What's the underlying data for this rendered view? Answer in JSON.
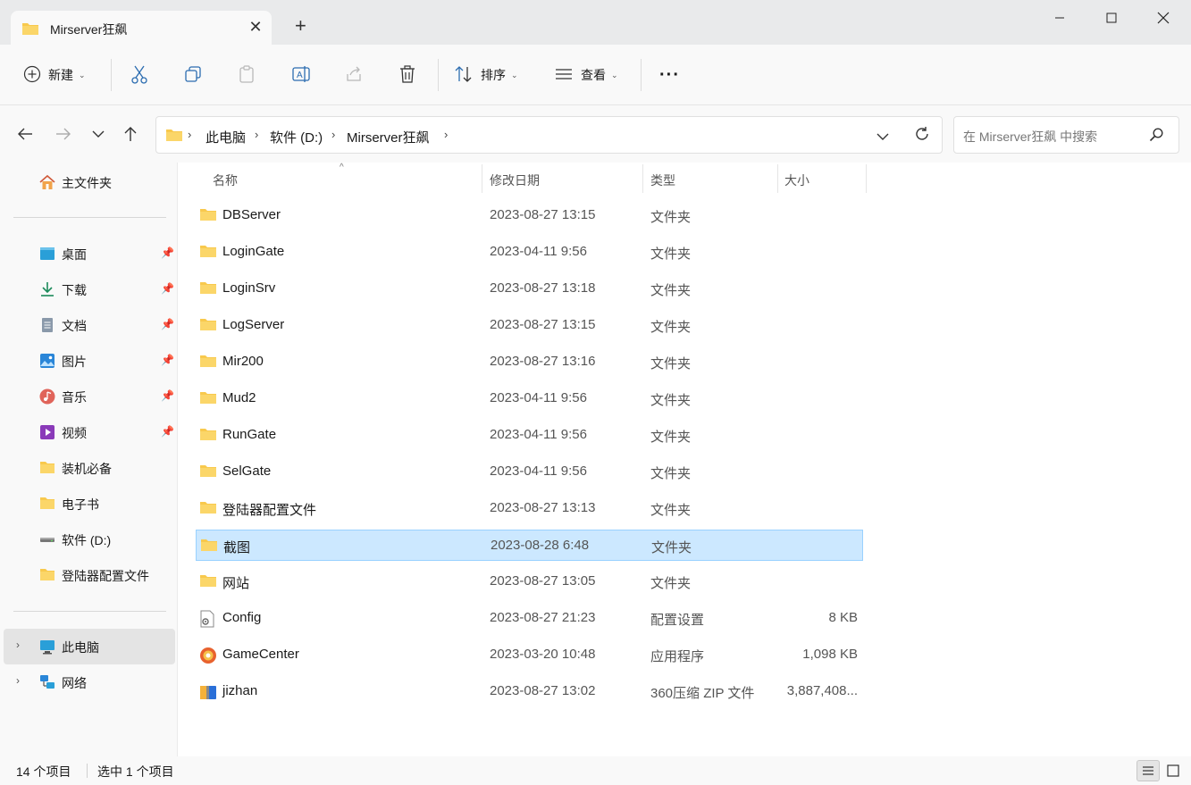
{
  "window": {
    "tab_title": "Mirserver狂飙",
    "close_tab": "✕",
    "new_tab": "+"
  },
  "toolbar": {
    "new_label": "新建",
    "sort_label": "排序",
    "view_label": "查看",
    "more_label": "···"
  },
  "address": {
    "crumbs": [
      "此电脑",
      "软件 (D:)",
      "Mirserver狂飙"
    ],
    "search_placeholder": "在 Mirserver狂飙 中搜索"
  },
  "sidebar": {
    "home": "主文件夹",
    "pinned": [
      {
        "label": "桌面",
        "icon": "desktop-icon"
      },
      {
        "label": "下载",
        "icon": "download-icon"
      },
      {
        "label": "文档",
        "icon": "document-icon"
      },
      {
        "label": "图片",
        "icon": "pictures-icon"
      },
      {
        "label": "音乐",
        "icon": "music-icon"
      },
      {
        "label": "视频",
        "icon": "video-icon"
      }
    ],
    "others": [
      {
        "label": "装机必备",
        "icon": "folder-icon"
      },
      {
        "label": "电子书",
        "icon": "folder-icon"
      },
      {
        "label": "软件 (D:)",
        "icon": "drive-icon"
      },
      {
        "label": "登陆器配置文件",
        "icon": "folder-icon"
      }
    ],
    "this_pc": "此电脑",
    "network": "网络"
  },
  "columns": {
    "name": "名称",
    "date": "修改日期",
    "type": "类型",
    "size": "大小"
  },
  "files": [
    {
      "name": "DBServer",
      "date": "2023-08-27 13:15",
      "type": "文件夹",
      "size": "",
      "icon": "folder"
    },
    {
      "name": "LoginGate",
      "date": "2023-04-11 9:56",
      "type": "文件夹",
      "size": "",
      "icon": "folder"
    },
    {
      "name": "LoginSrv",
      "date": "2023-08-27 13:18",
      "type": "文件夹",
      "size": "",
      "icon": "folder"
    },
    {
      "name": "LogServer",
      "date": "2023-08-27 13:15",
      "type": "文件夹",
      "size": "",
      "icon": "folder"
    },
    {
      "name": "Mir200",
      "date": "2023-08-27 13:16",
      "type": "文件夹",
      "size": "",
      "icon": "folder"
    },
    {
      "name": "Mud2",
      "date": "2023-04-11 9:56",
      "type": "文件夹",
      "size": "",
      "icon": "folder"
    },
    {
      "name": "RunGate",
      "date": "2023-04-11 9:56",
      "type": "文件夹",
      "size": "",
      "icon": "folder"
    },
    {
      "name": "SelGate",
      "date": "2023-04-11 9:56",
      "type": "文件夹",
      "size": "",
      "icon": "folder"
    },
    {
      "name": "登陆器配置文件",
      "date": "2023-08-27 13:13",
      "type": "文件夹",
      "size": "",
      "icon": "folder"
    },
    {
      "name": "截图",
      "date": "2023-08-28 6:48",
      "type": "文件夹",
      "size": "",
      "icon": "folder",
      "selected": true
    },
    {
      "name": "网站",
      "date": "2023-08-27 13:05",
      "type": "文件夹",
      "size": "",
      "icon": "folder"
    },
    {
      "name": "Config",
      "date": "2023-08-27 21:23",
      "type": "配置设置",
      "size": "8 KB",
      "icon": "config"
    },
    {
      "name": "GameCenter",
      "date": "2023-03-20 10:48",
      "type": "应用程序",
      "size": "1,098 KB",
      "icon": "app"
    },
    {
      "name": "jizhan",
      "date": "2023-08-27 13:02",
      "type": "360压缩 ZIP 文件",
      "size": "3,887,408...",
      "icon": "zip"
    }
  ],
  "status": {
    "count": "14 个项目",
    "selected": "选中 1 个项目"
  },
  "colors": {
    "selection": "#cce8ff",
    "selection_border": "#99d1ff",
    "folder": "#f8c94d"
  }
}
